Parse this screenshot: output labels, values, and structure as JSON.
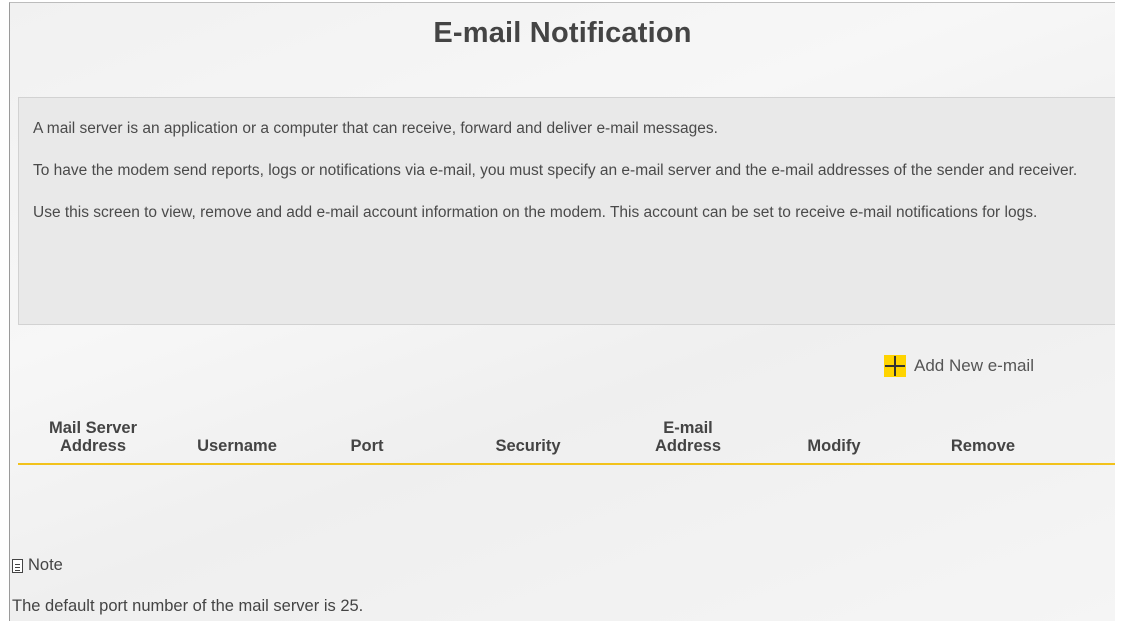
{
  "page": {
    "title": "E-mail Notification"
  },
  "info": {
    "paragraphs": [
      "A mail server is an application or a computer that can receive, forward and deliver e-mail messages.",
      "To have the modem send reports, logs or notifications via e-mail, you must specify an e-mail server and the e-mail addresses of the sender and receiver.",
      "Use this screen to view, remove and add e-mail account information on the modem. This account can be set to receive e-mail notifications for logs."
    ]
  },
  "actions": {
    "add_label": "Add New e-mail"
  },
  "table": {
    "columns": [
      [
        "Mail Server",
        "Address"
      ],
      [
        "Username"
      ],
      [
        "Port"
      ],
      [
        "Security"
      ],
      [
        "E-mail",
        "Address"
      ],
      [
        "Modify"
      ],
      [
        "Remove"
      ]
    ],
    "rows": []
  },
  "note": {
    "heading": "Note",
    "text": "The default port number of the mail server is 25."
  },
  "colors": {
    "accent": "#f2c21b",
    "plus_bg": "#ffd400"
  }
}
